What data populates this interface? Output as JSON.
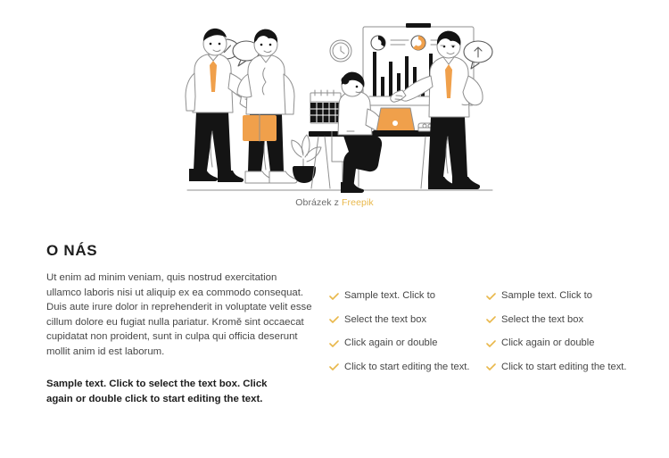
{
  "page": {
    "background": "#ffffff",
    "accent_color": "#e9b84b",
    "text_color": "#474747",
    "heading_color": "#1d1d1d"
  },
  "illustration": {
    "alt_name": "business-team-illustration",
    "description": "Line-art illustration of a business team: two men shaking hands with speech bubbles, a woman working at a desk on an orange laptop, and a man presenting a bar chart on a whiteboard",
    "accent_color": "#f0a04b",
    "ink_color": "#1a1a1a",
    "line_color": "#9a9a9a",
    "elements": [
      "handshake-pair",
      "speech-bubble-check",
      "speech-bubble-dots",
      "orange-tie",
      "orange-folder",
      "wall-clock",
      "wall-calendar",
      "potted-plant",
      "desk",
      "orange-laptop",
      "book-stack",
      "presentation-board",
      "bar-chart",
      "donut-chart-dark",
      "donut-chart-gold",
      "presenter",
      "speech-bubble-arrow-up"
    ],
    "board_chart": {
      "type": "bar",
      "bars": [
        54,
        22,
        40,
        26,
        46,
        34,
        13,
        50,
        20,
        52,
        11
      ],
      "donuts": [
        {
          "name": "donut-dark",
          "color": "#1a1a1a",
          "value": 70
        },
        {
          "name": "donut-gold",
          "color": "#f0a04b",
          "value": 65
        }
      ]
    }
  },
  "credit": {
    "prefix": "Obrázek z ",
    "link_label": "Freepik"
  },
  "about": {
    "title": "O NÁS",
    "paragraph": "Ut enim ad minim veniam, quis nostrud exercitation ullamco laboris nisi ut aliquip ex ea commodo consequat. Duis aute irure dolor in reprehenderit in voluptate velit esse cillum dolore eu fugiat nulla pariatur. Kromě sint occaecat cupidatat non proident, sunt in culpa qui officia deserunt mollit anim id est laborum.",
    "highlight": "Sample text. Click to select the text box. Click again or double click to start editing the text."
  },
  "check_columns": [
    {
      "name": "check-column-1",
      "items": [
        "Sample text. Click to",
        "Select the text box",
        "Click again or double",
        "Click to start editing the text."
      ]
    },
    {
      "name": "check-column-2",
      "items": [
        "Sample text. Click to",
        "Select the text box",
        "Click again or double",
        "Click to start editing the text."
      ]
    }
  ]
}
